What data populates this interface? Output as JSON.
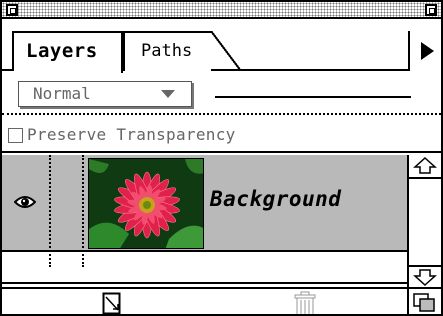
{
  "panel": {
    "tabs": [
      {
        "label": "Layers",
        "active": true
      },
      {
        "label": "Paths",
        "active": false
      }
    ],
    "blend_mode": {
      "selected": "Normal"
    },
    "preserve_transparency": {
      "label": "Preserve Transparency",
      "checked": false
    },
    "layers": [
      {
        "name": "Background",
        "visible": true,
        "thumbnail": "pink-gerbera-daisy"
      }
    ]
  },
  "icons": {
    "close": "close-box-icon",
    "zoom": "zoom-box-icon",
    "menu": "panel-menu-arrow-icon",
    "eye": "eye-icon",
    "scroll_up": "scroll-up-arrow-icon",
    "scroll_down": "scroll-down-arrow-icon",
    "new_layer": "new-layer-icon",
    "trash": "trash-icon",
    "grow": "grow-box-icon"
  },
  "colors": {
    "layer_row_bg": "#b9b9b9",
    "flower": "#e0224b",
    "leaves": "#1e6e1e"
  }
}
